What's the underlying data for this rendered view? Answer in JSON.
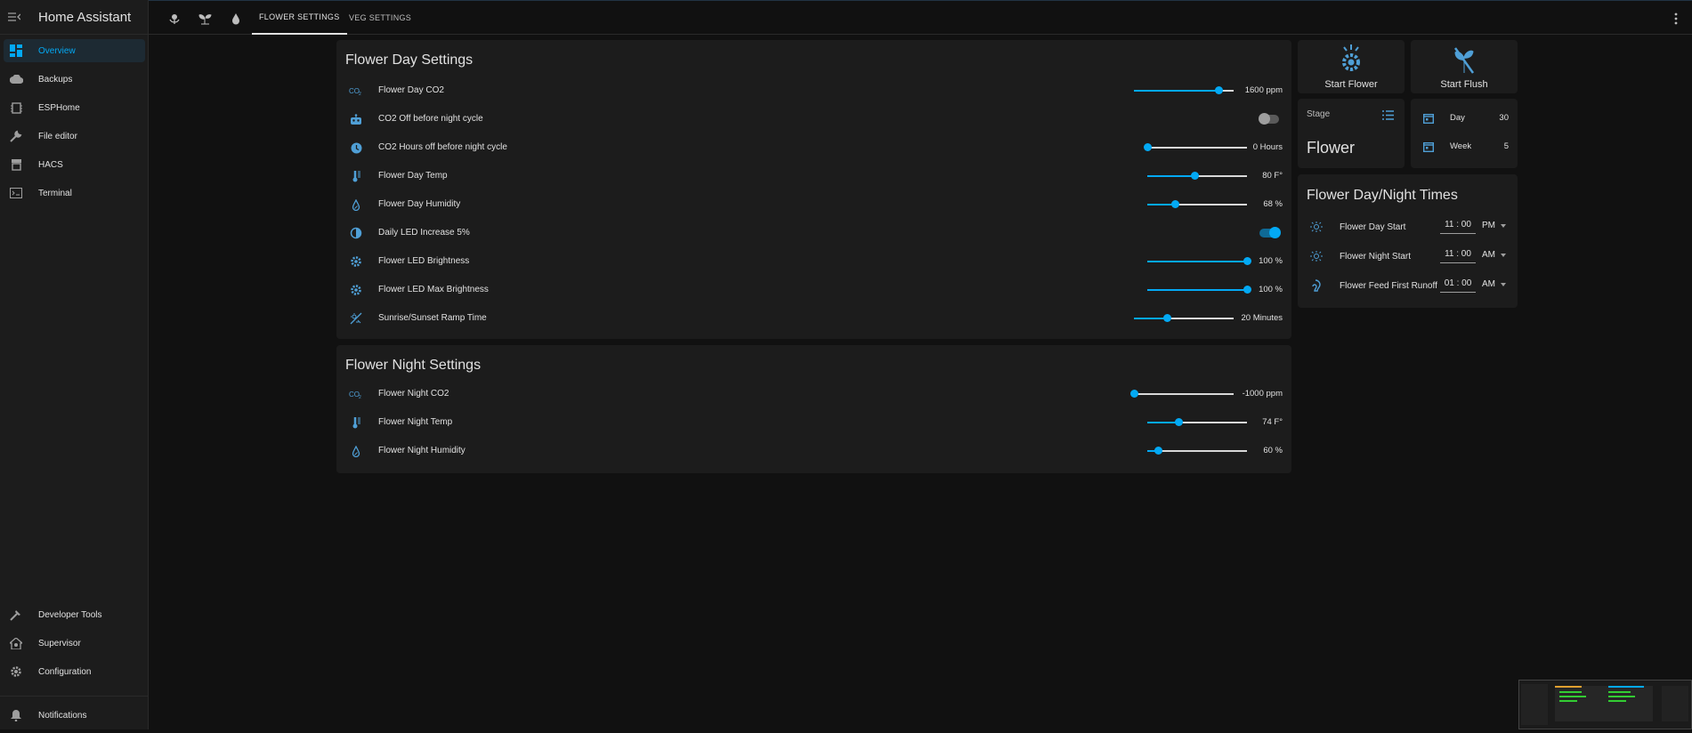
{
  "app": {
    "title": "Home Assistant"
  },
  "sidebar": {
    "items": [
      {
        "label": "Overview",
        "icon": "dashboard-icon",
        "active": true
      },
      {
        "label": "Backups",
        "icon": "cloud-icon"
      },
      {
        "label": "ESPHome",
        "icon": "esphome-icon"
      },
      {
        "label": "File editor",
        "icon": "wrench-icon"
      },
      {
        "label": "HACS",
        "icon": "hacs-icon"
      },
      {
        "label": "Terminal",
        "icon": "terminal-icon"
      }
    ],
    "bottom": [
      {
        "label": "Developer Tools",
        "icon": "hammer-icon"
      },
      {
        "label": "Supervisor",
        "icon": "supervisor-icon"
      },
      {
        "label": "Configuration",
        "icon": "gear-icon"
      },
      {
        "label": "Notifications",
        "icon": "bell-icon"
      }
    ]
  },
  "toolbar": {
    "icons": [
      "flower-icon",
      "sprout-icon",
      "water-drop-icon"
    ],
    "tabs": [
      {
        "label": "FLOWER SETTINGS",
        "active": true
      },
      {
        "label": "VEG SETTINGS"
      }
    ]
  },
  "day_card": {
    "title": "Flower Day Settings",
    "rows": [
      {
        "label": "Flower Day CO2",
        "value": "1600 ppm",
        "icon": "co2-icon",
        "control": "slider",
        "level": 0.85
      },
      {
        "label": "CO2 Off before night cycle",
        "icon": "robot-icon",
        "control": "toggle",
        "on": false
      },
      {
        "label": "CO2 Hours off before night cycle",
        "value": "0 Hours",
        "icon": "clock-icon",
        "control": "slider",
        "level": 0.0
      },
      {
        "label": "Flower Day Temp",
        "value": "80 F°",
        "icon": "thermometer-icon",
        "control": "slider",
        "level": 0.47
      },
      {
        "label": "Flower Day Humidity",
        "value": "68 %",
        "icon": "humidity-icon",
        "control": "slider",
        "level": 0.28
      },
      {
        "label": "Daily LED Increase 5%",
        "icon": "brightness-icon",
        "control": "toggle",
        "on": true
      },
      {
        "label": "Flower LED Brightness",
        "value": "100 %",
        "icon": "led-icon",
        "control": "slider",
        "level": 1.0
      },
      {
        "label": "Flower LED Max Brightness",
        "value": "100 %",
        "icon": "led-icon",
        "control": "slider",
        "level": 1.0
      },
      {
        "label": "Sunrise/Sunset Ramp Time",
        "value": "20 Minutes",
        "icon": "sun-ramp-icon",
        "control": "slider",
        "level": 0.33
      }
    ]
  },
  "night_card": {
    "title": "Flower Night Settings",
    "rows": [
      {
        "label": "Flower Night CO2",
        "value": "-1000 ppm",
        "icon": "co2-icon",
        "control": "slider",
        "level": 0.0
      },
      {
        "label": "Flower Night Temp",
        "value": "74 F°",
        "icon": "thermometer-icon",
        "control": "slider",
        "level": 0.31
      },
      {
        "label": "Flower Night Humidity",
        "value": "60 %",
        "icon": "humidity-icon",
        "control": "slider",
        "level": 0.11
      }
    ]
  },
  "buttons": {
    "start_flower": "Start Flower",
    "start_flush": "Start Flush"
  },
  "stage": {
    "label": "Stage",
    "value": "Flower"
  },
  "counters": [
    {
      "label": "Day",
      "value": "30"
    },
    {
      "label": "Week",
      "value": "5"
    }
  ],
  "times_card": {
    "title": "Flower Day/Night Times",
    "rows": [
      {
        "label": "Flower Day Start",
        "time": "11 : 00",
        "ampm": "PM",
        "icon": "sun-clock-icon"
      },
      {
        "label": "Flower Night Start",
        "time": "11 : 00",
        "ampm": "AM",
        "icon": "sun-clock-icon"
      },
      {
        "label": "Flower Feed First Runoff",
        "time": "01 : 00",
        "ampm": "AM",
        "icon": "feed-icon"
      }
    ]
  },
  "colors": {
    "accent": "#03a9f4",
    "bg": "#111111",
    "card": "#1c1c1c",
    "sidebar": "#1c1c1c"
  }
}
